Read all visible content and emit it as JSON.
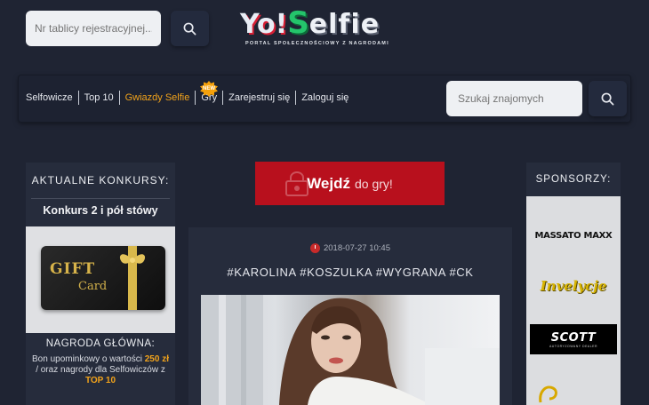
{
  "header": {
    "plate_search_placeholder": "Nr tablicy rejestracyjnej...",
    "logo": {
      "yo": "Yo!",
      "s": "S",
      "rest": "elfie",
      "tagline": "PORTAL SPOŁECZNOŚCIOWY Z NAGRODAMI"
    }
  },
  "nav": {
    "items": [
      {
        "label": "Selfowicze",
        "active": false
      },
      {
        "label": "Top 10",
        "active": false
      },
      {
        "label": "Gwiazdy Selfie",
        "active": true
      },
      {
        "label": "Gry",
        "active": false
      },
      {
        "label": "Zarejestruj się",
        "active": false
      },
      {
        "label": "Zaloguj się",
        "active": false
      }
    ],
    "new_badge": "NEW",
    "friend_search_placeholder": "Szukaj znajomych"
  },
  "left": {
    "heading": "AKTUALNE KONKURSY:",
    "contest_title": "Konkurs 2 i pół stówy",
    "gift_card": {
      "line1": "GIFT",
      "line2": "Card"
    },
    "prize_heading": "NAGRODA GŁÓWNA:",
    "prize_desc": {
      "part1": "Bon upominkowy o wartości ",
      "amount": "250 zł",
      "part2": " / oraz nagrody dla Selfowiczów z ",
      "top": "TOP 10"
    }
  },
  "cta": {
    "strong": "Wejdź",
    "light": "do gry!"
  },
  "post": {
    "date": "2018-07-27 10:45",
    "tags": "#KAROLINA #KOSZULKA #WYGRANA #CK"
  },
  "right": {
    "heading": "SPONSORZY:",
    "sponsors": [
      "MASSATO MAXX",
      "Invelycje",
      "SCOTT",
      "AUTORYZOWANY DEALER"
    ]
  },
  "colors": {
    "accent": "#f2a31b",
    "cta_red": "#b8101d",
    "background": "#1f2433",
    "panel": "#262c3c"
  }
}
